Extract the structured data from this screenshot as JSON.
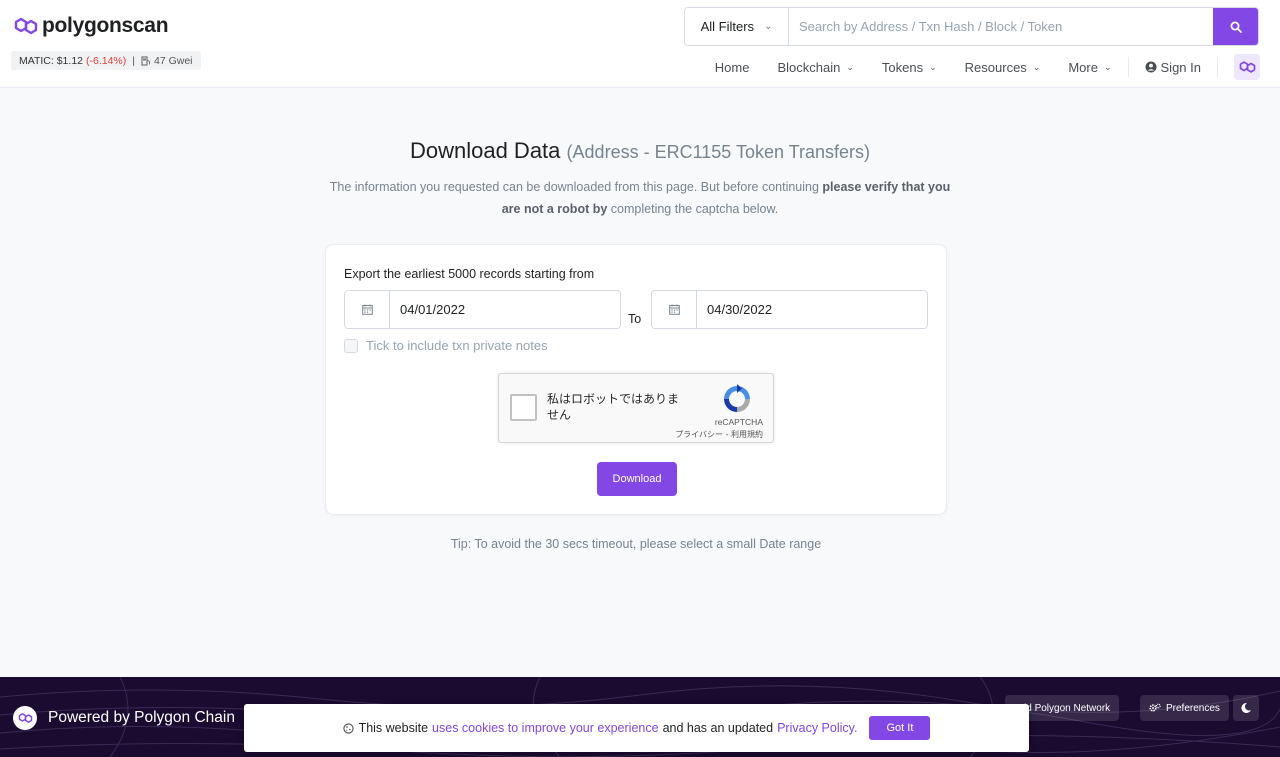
{
  "brand": {
    "name": "polygonscan"
  },
  "price_bar": {
    "matic": "MATIC: $1.12",
    "change": "(-6.14%)",
    "separator": "|",
    "gas": "47 Gwei"
  },
  "search": {
    "filter": "All Filters",
    "placeholder": "Search by Address / Txn Hash / Block / Token"
  },
  "nav": {
    "home": "Home",
    "blockchain": "Blockchain",
    "tokens": "Tokens",
    "resources": "Resources",
    "more": "More",
    "sign_in": "Sign In"
  },
  "page": {
    "title": "Download Data",
    "subtitle": "(Address - ERC1155 Token Transfers)",
    "intro_1": "The information you requested can be downloaded from this page. But before continuing",
    "intro_bold_1": "please verify that you are not a robot by",
    "intro_2": "completing the captcha below."
  },
  "form": {
    "label": "Export the earliest 5000 records starting from",
    "from_date": "04/01/2022",
    "to_label": "To",
    "to_date": "04/30/2022",
    "checkbox_label": "Tick to include txn private notes",
    "download": "Download"
  },
  "captcha": {
    "text": "私はロボットではありません",
    "brand": "reCAPTCHA",
    "links": "プライバシー - 利用規約"
  },
  "tip": "Tip: To avoid the 30 secs timeout, please select a small Date range",
  "footer": {
    "powered": "Powered by Polygon Chain",
    "add_network": "Add Polygon Network",
    "preferences": "Preferences"
  },
  "cookie": {
    "text_1": "This website",
    "link_1": "uses cookies to improve your experience",
    "text_2": "and has an updated",
    "link_2": "Privacy Policy.",
    "button": "Got It"
  },
  "colors": {
    "accent": "#8247e5",
    "negative": "#de4437",
    "footer_bg": "#1a0b30"
  }
}
